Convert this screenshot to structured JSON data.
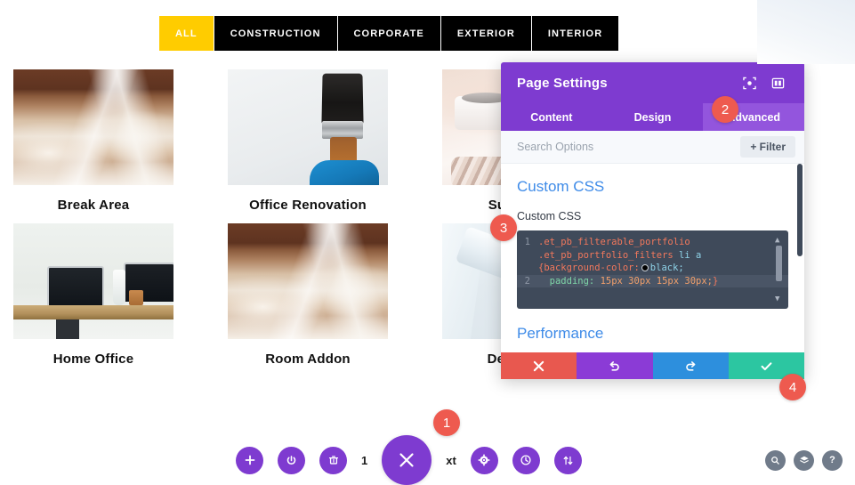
{
  "filter_bar": {
    "items": [
      {
        "label": "ALL",
        "active": true
      },
      {
        "label": "CONSTRUCTION",
        "active": false
      },
      {
        "label": "CORPORATE",
        "active": false
      },
      {
        "label": "EXTERIOR",
        "active": false
      },
      {
        "label": "INTERIOR",
        "active": false
      }
    ]
  },
  "portfolio": {
    "rows": [
      [
        {
          "caption": "Break Area",
          "image": "lumber-planks-photo"
        },
        {
          "caption": "Office Renovation",
          "image": "paintbrush-gloved-hand-photo"
        },
        {
          "caption": "Sun Room",
          "image": "sunroom-decor-photo"
        }
      ],
      [
        {
          "caption": "Home Office",
          "image": "home-office-desk-photo"
        },
        {
          "caption": "Room Addon",
          "image": "lumber-planks-photo"
        },
        {
          "caption": "Deck Patio",
          "image": "paint-roller-photo"
        }
      ]
    ]
  },
  "panel": {
    "title": "Page Settings",
    "header_icons": [
      {
        "name": "focus-target-icon"
      },
      {
        "name": "panel-layout-icon"
      }
    ],
    "tabs": [
      {
        "label": "Content",
        "active": false
      },
      {
        "label": "Design",
        "active": false
      },
      {
        "label": "Advanced",
        "active": true
      }
    ],
    "search": {
      "value": "",
      "placeholder": "Search Options"
    },
    "filter_button": "+ Filter",
    "sections": {
      "custom_css": {
        "title": "Custom CSS",
        "field_label": "Custom CSS",
        "code": {
          "line1_number": "1",
          "line2_number": "2",
          "line1_selector_a": ".et_pb_filterable_portfolio",
          "line1_selector_b": ".et_pb_portfolio_filters",
          "line1_tag": "li a",
          "line1_open_brace": "{",
          "line1_property": "background-color:",
          "line1_value": "black;",
          "line2_property": "padding:",
          "line2_value": "15px 30px 15px 30px;",
          "line2_close_brace": "}"
        }
      },
      "performance": {
        "title": "Performance"
      }
    },
    "actions": [
      {
        "name": "cancel-button",
        "icon": "✕",
        "color": "#E8584F"
      },
      {
        "name": "undo-button",
        "icon": "↺",
        "color": "#8B3BD6"
      },
      {
        "name": "redo-button",
        "icon": "↻",
        "color": "#2D8FDD"
      },
      {
        "name": "save-button",
        "icon": "✔",
        "color": "#2CC6A1"
      }
    ]
  },
  "badges": [
    {
      "number": "1",
      "target": "settings-gear-button"
    },
    {
      "number": "2",
      "target": "advanced-tab"
    },
    {
      "number": "3",
      "target": "custom-css-code-editor"
    },
    {
      "number": "4",
      "target": "save-button"
    }
  ],
  "toolbar": {
    "buttons": [
      {
        "name": "add-button",
        "icon": "+"
      },
      {
        "name": "power-toggle-button",
        "icon": "⏻"
      },
      {
        "name": "trash-button",
        "icon": "🗑"
      }
    ],
    "occluded_text_left": "1",
    "main_button": {
      "name": "close-builder-button",
      "icon": "✕"
    },
    "occluded_text_right": "xt",
    "buttons_right": [
      {
        "name": "settings-gear-button",
        "icon": "✿"
      },
      {
        "name": "history-clock-button",
        "icon": "◷"
      },
      {
        "name": "sort-updown-button",
        "icon": "⇅"
      }
    ],
    "corner_buttons": [
      {
        "name": "search-magnifier-button",
        "icon": "⌕"
      },
      {
        "name": "layers-button",
        "icon": "≋"
      },
      {
        "name": "help-button",
        "icon": "?"
      }
    ]
  },
  "colors": {
    "accent_purple": "#7E3BD0",
    "tab_active_purple": "#9355DD",
    "filter_active_yellow": "#FFCC00",
    "badge_red": "#EE5A4F",
    "section_title_blue": "#3E8BE8",
    "code_bg": "#3F4A5A",
    "save_green": "#2CC6A1"
  }
}
